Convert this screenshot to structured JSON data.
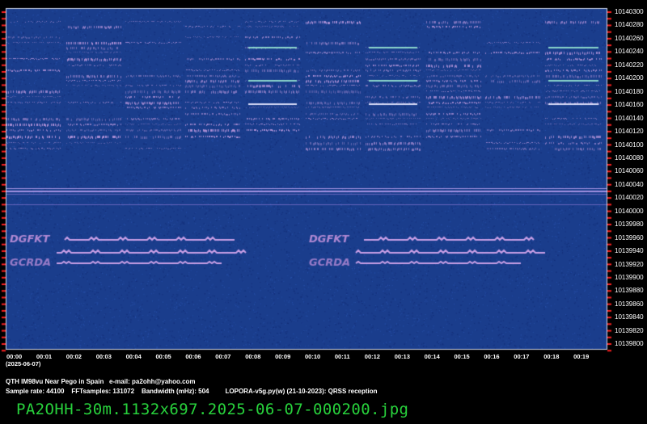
{
  "colors": {
    "background": "#1a3d8c",
    "signal": "#c9a6e6",
    "text": "#ffffff",
    "filename": "#28d23c",
    "tick": "#ff2020"
  },
  "frequency_labels": [
    "10140300",
    "10140280",
    "10140260",
    "10140240",
    "10140220",
    "10140200",
    "10140180",
    "10140160",
    "10140140",
    "10140120",
    "10140100",
    "10140080",
    "10140060",
    "10140040",
    "10140020",
    "10140000",
    "10139980",
    "10139960",
    "10139940",
    "10139920",
    "10139900",
    "10139880",
    "10139860",
    "10139840",
    "10139820",
    "10139800"
  ],
  "time_labels": [
    "00:00",
    "00:01",
    "00:02",
    "00:03",
    "00:04",
    "00:05",
    "00:06",
    "00:07",
    "00:08",
    "00:09",
    "00:10",
    "00:11",
    "00:12",
    "00:13",
    "00:14",
    "00:15",
    "00:16",
    "00:17",
    "00:18",
    "00:19"
  ],
  "date_label": "(2025-06-07)",
  "info_line1": "QTH IM98vu Near Pego in Spain   e-mail: pa2ohh@yahoo.com",
  "info_line2": "Sample rate: 44100    FFTsamples: 131072    Bandwidth (mHz): 504         LOPORA-v5g.py(w) (21-10-2023): QRSS reception",
  "filename": "PA2OHH-30m.1132x697.2025-06-07-000200.jpg",
  "callsign_text": "DGFKT",
  "callsign_text2": "GCRDA"
}
